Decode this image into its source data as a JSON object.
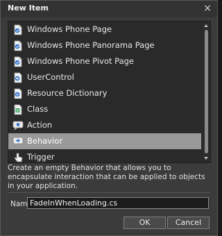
{
  "dialog": {
    "title": "New Item",
    "close_glyph": "×"
  },
  "items": [
    {
      "label": "Windows Phone Page",
      "icon": "page-icon",
      "selected": false
    },
    {
      "label": "Windows Phone Panorama Page",
      "icon": "page-icon",
      "selected": false
    },
    {
      "label": "Windows Phone Pivot Page",
      "icon": "page-icon",
      "selected": false
    },
    {
      "label": "UserControl",
      "icon": "usercontrol-icon",
      "selected": false
    },
    {
      "label": "Resource Dictionary",
      "icon": "resource-dictionary-icon",
      "selected": false
    },
    {
      "label": "Class",
      "icon": "class-icon",
      "selected": false
    },
    {
      "label": "Action",
      "icon": "action-icon",
      "selected": false
    },
    {
      "label": "Behavior",
      "icon": "behavior-icon",
      "selected": true
    },
    {
      "label": "Trigger",
      "icon": "trigger-icon",
      "selected": false
    }
  ],
  "description": "Create an empty Behavior that allows you to encapsulate interaction that can be applied to objects in your application.",
  "name_field": {
    "label": "Name",
    "value": "FadeInWhenLoading.cs"
  },
  "buttons": {
    "ok": "OK",
    "cancel": "Cancel"
  },
  "colors": {
    "background": "#3b3b3b",
    "list_background": "#2a2a2a",
    "selection": "#999999",
    "icon_blue": "#2f6fc9"
  }
}
